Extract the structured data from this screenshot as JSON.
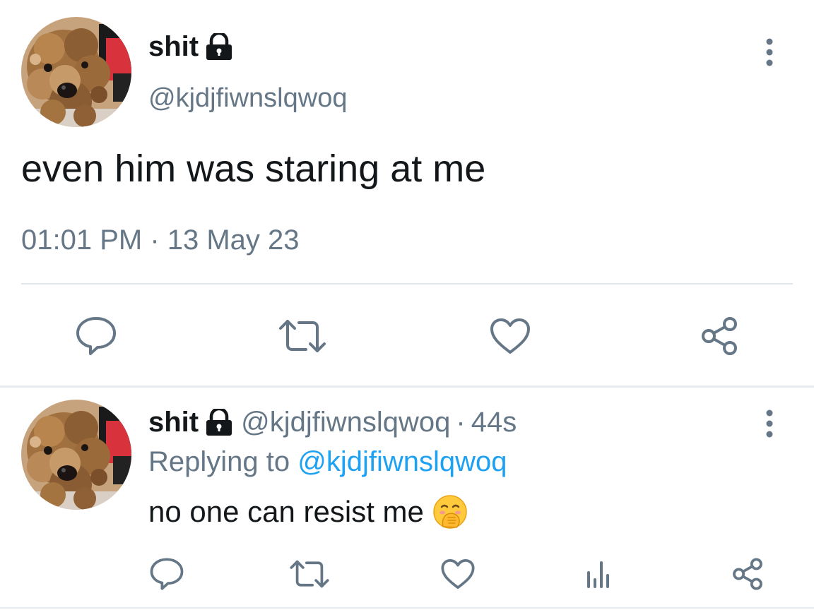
{
  "main_tweet": {
    "display_name": "shit",
    "handle": "@kjdjfiwnslqwoq",
    "text": "even him was staring at me",
    "timestamp": "01:01 PM · 13 May 23",
    "icons": {
      "lock": "lock-icon",
      "more": "more-vertical-icon",
      "reply": "reply-icon",
      "retweet": "retweet-icon",
      "like": "heart-icon",
      "share": "share-icon"
    }
  },
  "reply_tweet": {
    "display_name": "shit",
    "handle": "@kjdjfiwnslqwoq",
    "separator": "·",
    "age": "44s",
    "replying_prefix": "Replying to",
    "replying_handle": "@kjdjfiwnslqwoq",
    "text": "no one can resist me",
    "icons": {
      "lock": "lock-icon",
      "emoji": "hand-over-mouth-emoji-icon",
      "more": "more-vertical-icon",
      "reply": "reply-icon",
      "retweet": "retweet-icon",
      "like": "heart-icon",
      "analytics": "analytics-icon",
      "share": "share-icon"
    }
  },
  "colors": {
    "text_primary": "#14171a",
    "text_secondary": "#657786",
    "link": "#1da1f2",
    "divider": "#e1e8ed",
    "icon": "#657786"
  }
}
